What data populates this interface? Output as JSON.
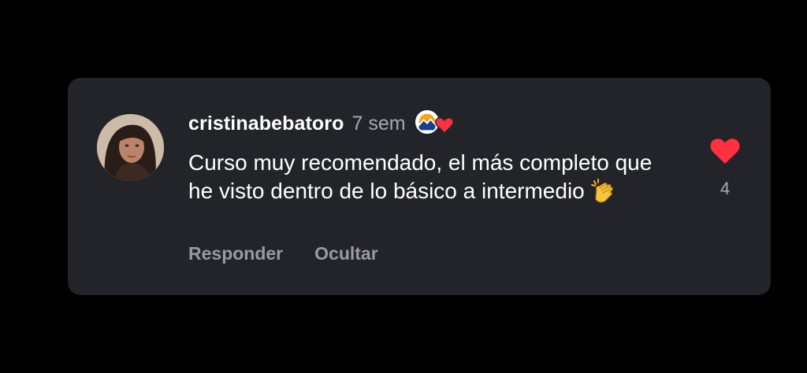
{
  "comment": {
    "username": "cristinabebatoro",
    "time": "7 sem",
    "text": "Curso muy recomendado, el más completo que he visto dentro de lo básico a intermedio",
    "emoji": "clapping-hands",
    "creator_liked": true
  },
  "actions": {
    "reply_label": "Responder",
    "hide_label": "Ocultar"
  },
  "likes": {
    "count": "4",
    "liked": true
  },
  "colors": {
    "card_background": "#232429",
    "page_background": "#000000",
    "heart": "#ff3040",
    "primary_text": "#ffffff",
    "secondary_text": "#a8a8ad"
  }
}
